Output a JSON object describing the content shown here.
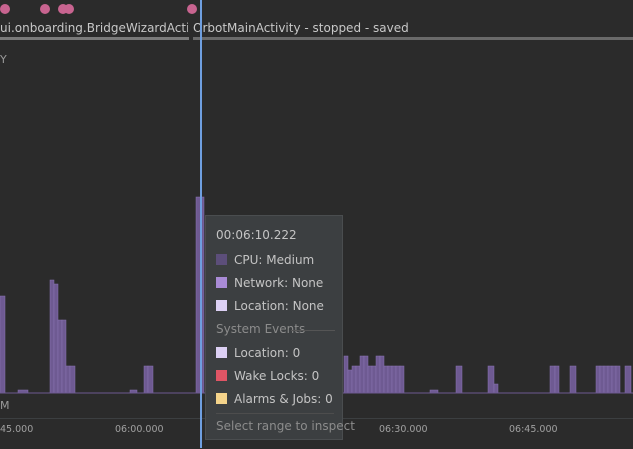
{
  "activities": {
    "left_label": "ui.onboarding.BridgeWizardActivit...",
    "right_label": "OrbotMainActivity - stopped - saved"
  },
  "energy_label_fragment": "Y",
  "memory_label_fragment": "M",
  "axis": {
    "ticks": [
      "45.000",
      "06:00.000",
      "06:30.000",
      "06:45.000"
    ]
  },
  "tooltip": {
    "time": "00:06:10.222",
    "rows": [
      {
        "label": "CPU: Medium",
        "color": "#5c4e7a"
      },
      {
        "label": "Network: None",
        "color": "#a98bd6"
      },
      {
        "label": "Location: None",
        "color": "#dcd0f4"
      }
    ],
    "section_title": "System Events",
    "events": [
      {
        "label": "Location: 0",
        "color": "#dcd0f4"
      },
      {
        "label": "Wake Locks: 0",
        "color": "#e05565"
      },
      {
        "label": "Alarms & Jobs: 0",
        "color": "#f4d38a"
      }
    ],
    "hint": "Select range to inspect"
  },
  "colors": {
    "bar": "#6e5a92",
    "bar_line": "#8a74b3",
    "event_dot": "#c86490",
    "cursor": "#6f9fe0"
  }
}
